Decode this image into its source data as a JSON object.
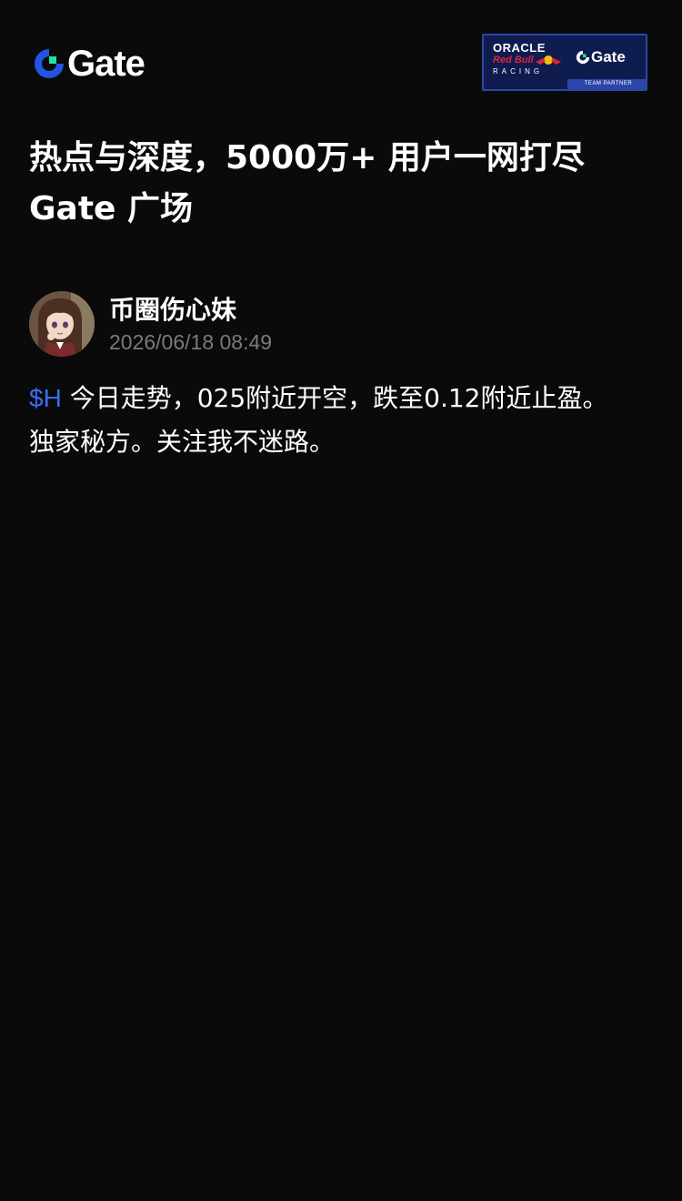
{
  "header": {
    "brand": "Gate",
    "partner_badge": {
      "line1": "ORACLE",
      "line2": "Red Bull",
      "line3": "RACING",
      "brand": "Gate",
      "strip": "TEAM PARTNER"
    }
  },
  "title": {
    "line1": "热点与深度，5000万+ 用户一网打尽",
    "line2": "Gate 广场"
  },
  "post": {
    "author": "币圈伤心妹",
    "time": "2026/06/18 08:49",
    "ticker": "$H",
    "line1": " 今日走势，025附近开空，跌至0.12附近止盈。",
    "line2": "独家秘方。关注我不迷路。"
  },
  "colors": {
    "background": "#0a0a0a",
    "ticker": "#3b6cf6",
    "muted": "#7a7a7a",
    "brand_blue": "#2354e6",
    "brand_green": "#17e6a1"
  },
  "icons": {
    "logo": "gate-logo-icon",
    "avatar": "anime-girl-avatar"
  }
}
